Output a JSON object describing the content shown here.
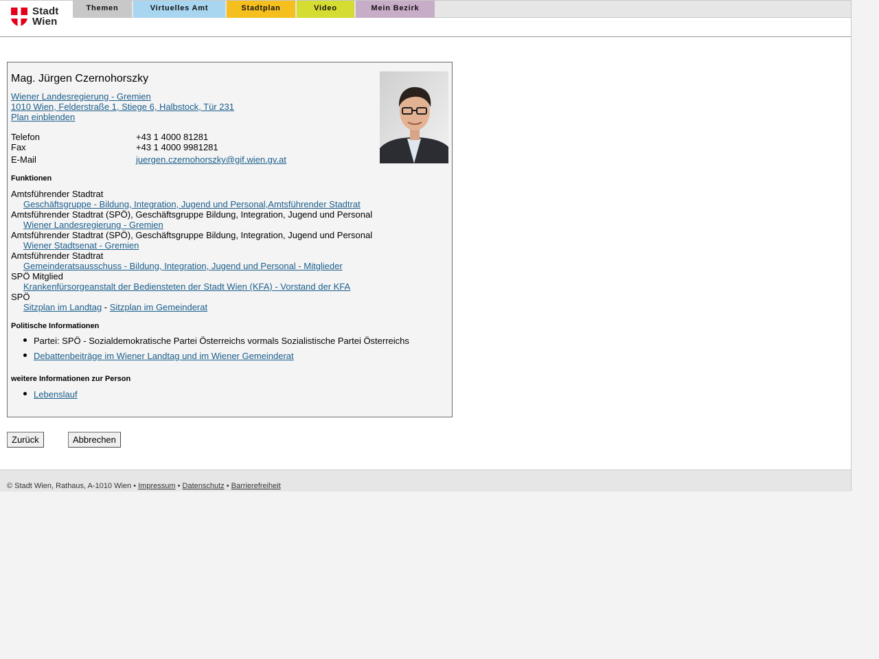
{
  "header": {
    "logo_line1": "Stadt",
    "logo_line2": "Wien",
    "nav": [
      {
        "label": "Themen",
        "color": "#c8c8c8"
      },
      {
        "label": "Virtuelles Amt",
        "color": "#a8d5f0"
      },
      {
        "label": "Stadtplan",
        "color": "#f5bf1e"
      },
      {
        "label": "Video",
        "color": "#d5dc32"
      },
      {
        "label": "Mein Bezirk",
        "color": "#c8adc8"
      }
    ]
  },
  "person": {
    "name": "Mag. Jürgen Czernohorszky",
    "org_link": "Wiener Landesregierung - Gremien ",
    "address_link": "1010 Wien, Felderstraße 1, Stiege 6, Halbstock, Tür 231",
    "map_link": "Plan einblenden",
    "phone_label": "Telefon",
    "phone": "+43 1 4000 81281",
    "fax_label": "Fax",
    "fax": "+43 1 4000 9981281",
    "email_label": "E-Mail",
    "email": "juergen.czernohorszky@gif.wien.gv.at"
  },
  "functions": {
    "heading": "Funktionen",
    "items": [
      {
        "role": "Amtsführender Stadtrat",
        "link": "Geschäftsgruppe - Bildung, Integration, Jugend und Personal,Amtsführender Stadtrat"
      },
      {
        "role": "Amtsführender Stadtrat (SPÖ), Geschäftsgruppe Bildung, Integration, Jugend und Personal",
        "link": "Wiener Landesregierung - Gremien"
      },
      {
        "role": "Amtsführender Stadtrat (SPÖ), Geschäftsgruppe Bildung, Integration, Jugend und Personal",
        "link": "Wiener Stadtsenat - Gremien"
      },
      {
        "role": "Amtsführender Stadtrat",
        "link": "Gemeinderatsausschuss - Bildung, Integration, Jugend und Personal - Mitglieder"
      },
      {
        "role": "SPÖ Mitglied",
        "link": "Krankenfürsorgeanstalt der Bediensteten der Stadt Wien (KFA) - Vorstand der KFA"
      }
    ],
    "party": "SPÖ",
    "seat_link_1": "Sitzplan im Landtag",
    "seat_separator": " - ",
    "seat_link_2": "Sitzplan im Gemeinderat"
  },
  "political": {
    "heading": "Politische Informationen",
    "party_text": "Partei: SPÖ - Sozialdemokratische Partei Österreichs vormals Sozialistische Partei Österreichs",
    "debate_link": "Debattenbeiträge im Wiener Landtag und im Wiener Gemeinderat"
  },
  "more": {
    "heading": "weitere Informationen zur Person",
    "cv_link": "Lebenslauf"
  },
  "buttons": {
    "back": "Zurück",
    "cancel": "Abbrechen"
  },
  "footer": {
    "copyright": "© Stadt Wien, Rathaus, A-1010 Wien •",
    "impressum": "Impressum",
    "datenschutz": "Datenschutz",
    "barrierefreiheit": "Barrierefreiheit",
    "sep": "•"
  }
}
